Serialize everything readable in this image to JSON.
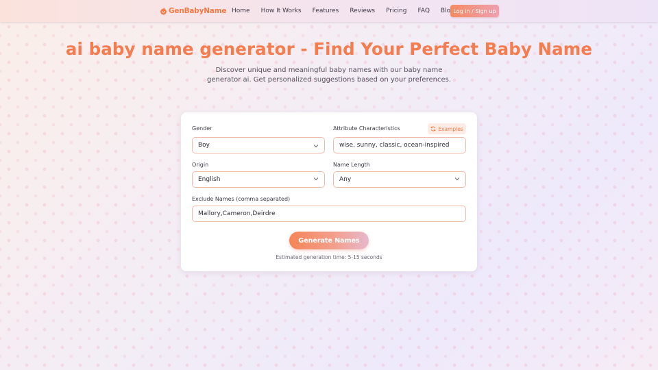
{
  "header": {
    "logo_text": "GenBabyName",
    "nav": [
      "Home",
      "How It Works",
      "Features",
      "Reviews",
      "Pricing",
      "FAQ",
      "Blog"
    ],
    "login_label": "Log in / Sign up"
  },
  "hero": {
    "title": "ai baby name generator - Find Your Perfect Baby Name",
    "subtitle": "Discover unique and meaningful baby names with our baby name generator ai. Get personalized suggestions based on your preferences."
  },
  "form": {
    "gender": {
      "label": "Gender",
      "value": "Boy"
    },
    "attributes": {
      "label": "Attribute Characteristics",
      "value": "wise, sunny, classic, ocean-inspired",
      "examples_label": "Examples"
    },
    "origin": {
      "label": "Origin",
      "value": "English"
    },
    "name_length": {
      "label": "Name Length",
      "value": "Any"
    },
    "exclude": {
      "label": "Exclude Names (comma separated)",
      "value": "Mallory,Cameron,Deirdre"
    },
    "generate_label": "Generate Names",
    "estimate": "Estimated generation time: 5-15 seconds"
  },
  "colors": {
    "accent": "#f47a45",
    "field_border": "#f6b9a8"
  },
  "icons": {
    "logo": "baby-face-icon",
    "examples": "refresh-icon",
    "select": "chevron-down-icon"
  }
}
